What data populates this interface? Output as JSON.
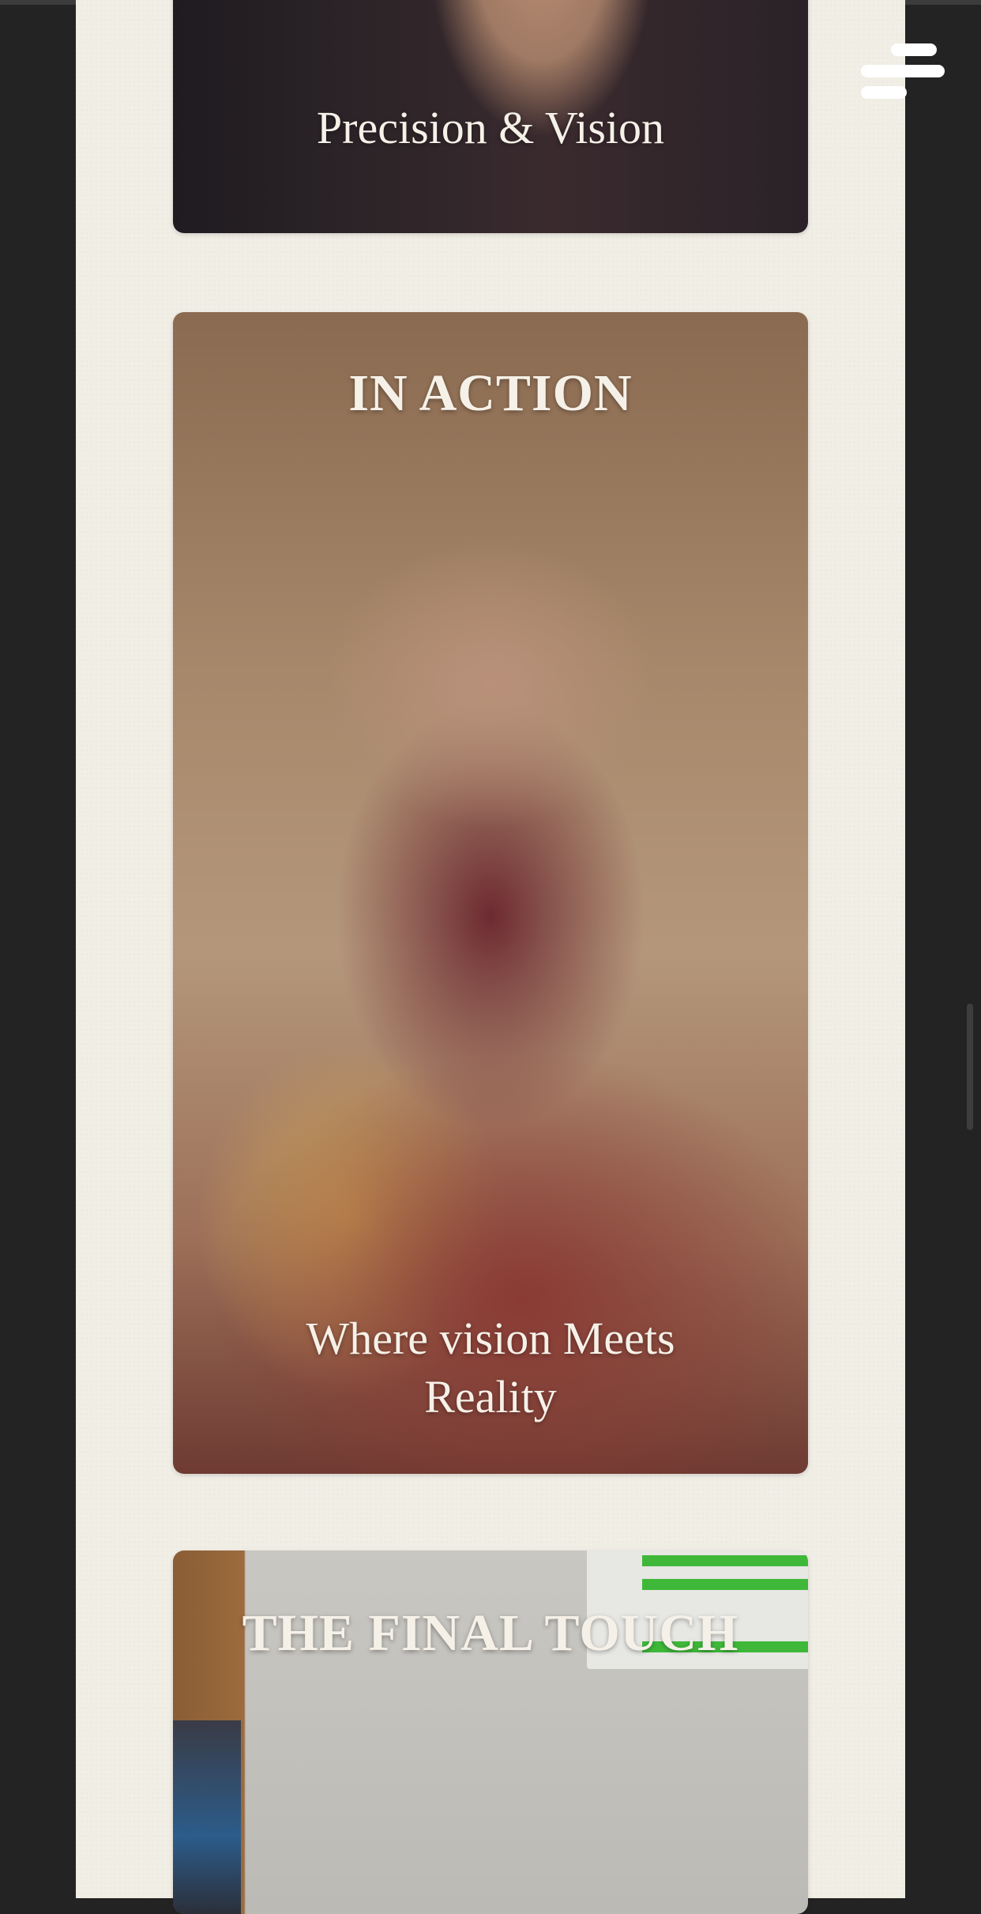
{
  "cards": [
    {
      "caption": "Precision & Vision"
    },
    {
      "title": "IN ACTION",
      "caption_line1": "Where vision Meets",
      "caption_line2": "Reality"
    },
    {
      "title": "THE FINAL TOUCH"
    }
  ],
  "menu": {
    "icon": "menu-icon"
  },
  "colors": {
    "page_bg": "#f1eee6",
    "outer_bg": "#232323",
    "text_on_image": "#f6f1e8"
  }
}
